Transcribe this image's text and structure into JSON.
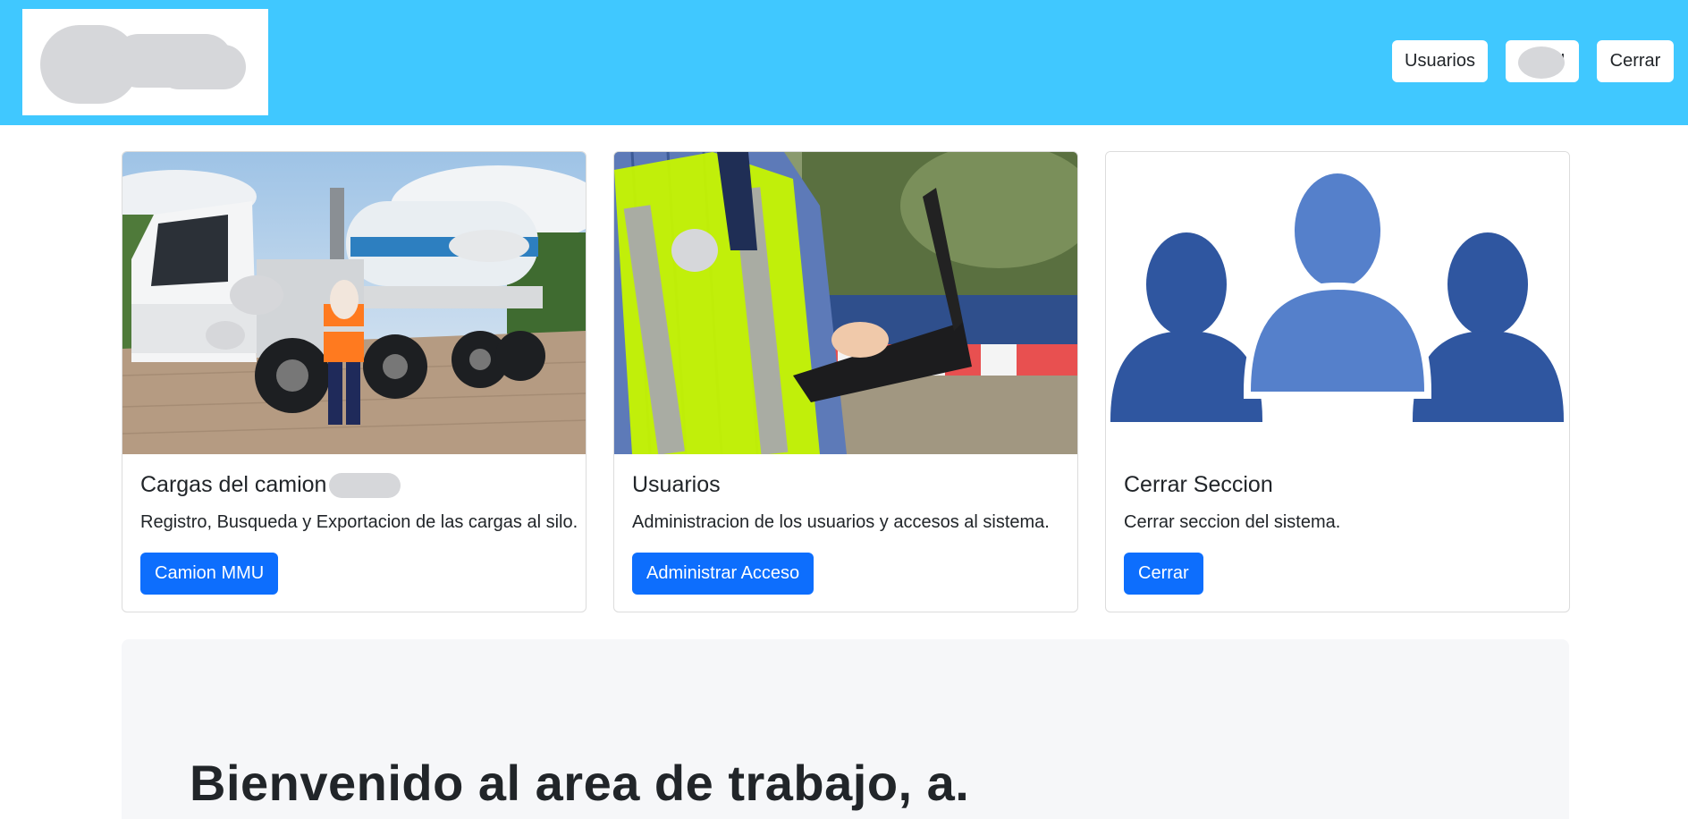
{
  "header": {
    "logo_icon": "company-logo-redacted",
    "nav": {
      "users_label": "Usuarios",
      "user_label": "U",
      "close_label": "Cerrar"
    }
  },
  "cards": [
    {
      "title": "Cargas del camion",
      "text": "Registro, Busqueda y Exportacion de las cargas al silo.",
      "button": "Camion MMU",
      "image": "truck-photo"
    },
    {
      "title": "Usuarios",
      "text": "Administracion de los usuarios y accesos al sistema.",
      "button": "Administrar Acceso",
      "image": "worker-laptop-photo"
    },
    {
      "title": "Cerrar Seccion",
      "text": "Cerrar seccion del sistema.",
      "button": "Cerrar",
      "image": "users-group-icon"
    }
  ],
  "welcome": {
    "heading": "Bienvenido al area de trabajo, a."
  },
  "colors": {
    "navbar": "#40c8ff",
    "primary": "#0d6efd",
    "people_dark": "#2f56a0",
    "people_light": "#5580cb",
    "redaction": "#d6d7da"
  }
}
